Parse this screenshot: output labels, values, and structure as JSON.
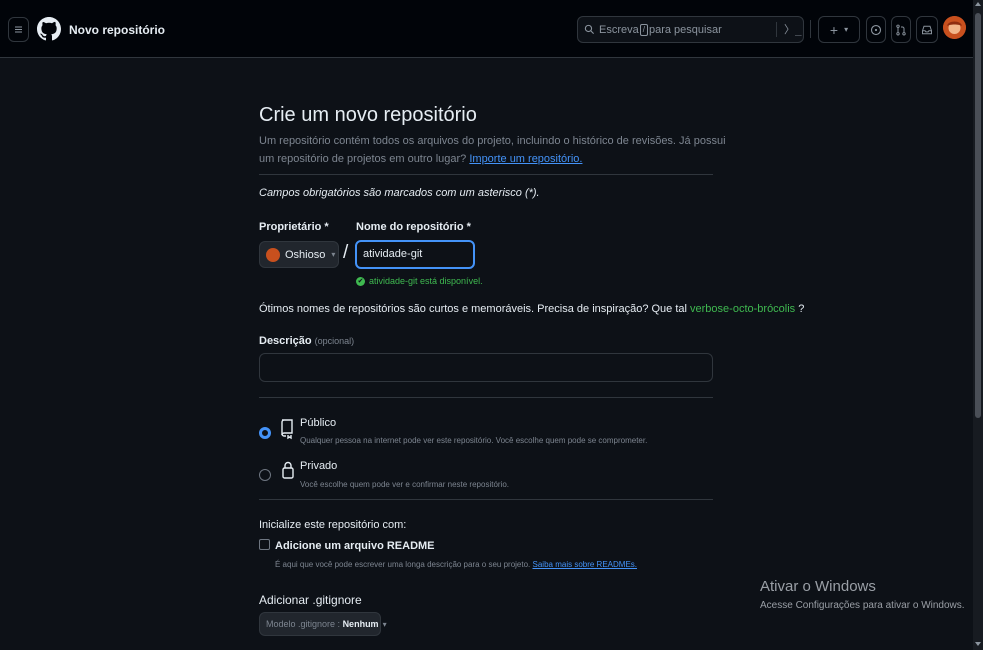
{
  "header": {
    "context_title": "Novo repositório",
    "search_placeholder_before": "Escreva",
    "search_key": "/",
    "search_placeholder_after": "para pesquisar",
    "command_icon": "terminal-icon",
    "create_label": "+",
    "create_caret": "▾"
  },
  "page": {
    "title": "Crie um novo repositório",
    "description": "Um repositório contém todos os arquivos do projeto, incluindo o histórico de revisões. Já possui um repositório de projetos em outro lugar?",
    "import_link": "Importe um repositório.",
    "required_note": "Campos obrigatórios são marcados com um asterisco (*).",
    "owner_label": "Proprietário *",
    "owner_value": "Oshioso",
    "owner_caret": "▾",
    "slash": "/",
    "repo_name_label": "Nome do repositório *",
    "repo_name_value": "atividade-git",
    "availability": "atividade-git está disponível.",
    "availability_icon": "✔",
    "tip_text": "Ótimos nomes de repositórios são curtos e memoráveis. Precisa de inspiração? Que tal",
    "tip_suggestion": "verbose-octo-brócolis",
    "tip_end": "?",
    "description_label": "Descrição",
    "description_optional": "(opcional)",
    "description_value": "",
    "visibility": {
      "public_title": "Público",
      "public_sub": "Qualquer pessoa na internet pode ver este repositório. Você escolhe quem pode se comprometer.",
      "private_title": "Privado",
      "private_sub": "Você escolhe quem pode ver e confirmar neste repositório.",
      "selected": "public"
    },
    "init_label": "Inicialize este repositório com:",
    "readme_label": "Adicione um arquivo README",
    "readme_sub": "É aqui que você pode escrever uma longa descrição para o seu projeto.",
    "readme_link": "Saiba mais sobre READMEs.",
    "readme_checked": false,
    "gitignore_label": "Adicionar .gitignore",
    "gitignore_prefix": "Modelo .gitignore :",
    "gitignore_value": "Nenhum",
    "gitignore_caret": "▾"
  },
  "watermark": {
    "title": "Ativar o Windows",
    "subtitle": "Acesse Configurações para ativar o Windows."
  },
  "colors": {
    "background": "#0d1117",
    "accent": "#4493f8",
    "success": "#3fb950",
    "muted": "#7d8590"
  }
}
